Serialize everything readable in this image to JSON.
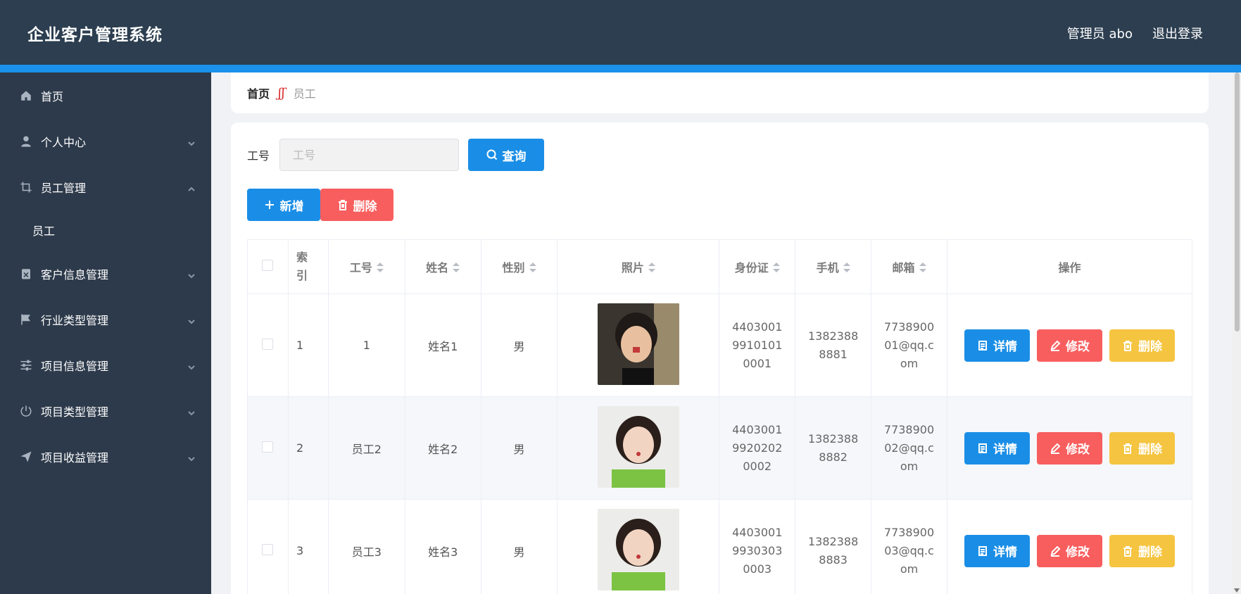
{
  "header": {
    "title": "企业客户管理系统",
    "user": "管理员 abo",
    "logout": "退出登录",
    "bg_color": "#2c3e50",
    "accent_color": "#1a91ea"
  },
  "sidebar": {
    "items": [
      {
        "label": "首页",
        "icon": "home-icon"
      },
      {
        "label": "个人中心",
        "icon": "user-icon",
        "expandable": true
      },
      {
        "label": "员工管理",
        "icon": "crop-icon",
        "expandable": true,
        "expanded": true
      },
      {
        "label": "员工",
        "submenu": true
      },
      {
        "label": "客户信息管理",
        "icon": "clipboard-icon",
        "expandable": true
      },
      {
        "label": "行业类型管理",
        "icon": "flag-icon",
        "expandable": true
      },
      {
        "label": "项目信息管理",
        "icon": "sliders-icon",
        "expandable": true
      },
      {
        "label": "项目类型管理",
        "icon": "power-icon",
        "expandable": true
      },
      {
        "label": "项目收益管理",
        "icon": "send-icon",
        "expandable": true
      }
    ]
  },
  "breadcrumb": {
    "home": "首页",
    "separator": "ʃʃ",
    "current": "员工"
  },
  "search": {
    "label": "工号",
    "placeholder": "工号",
    "value": "",
    "button": "查询"
  },
  "actions": {
    "add": "新增",
    "delete": "删除"
  },
  "table": {
    "columns": [
      "索引",
      "工号",
      "姓名",
      "性别",
      "照片",
      "身份证",
      "手机",
      "邮箱",
      "操作"
    ],
    "rows": [
      {
        "index": "1",
        "emp_no": "1",
        "name": "姓名1",
        "gender": "男",
        "id_card": "440300199101010001",
        "phone": "13823888881",
        "email": "773890001@qq.com"
      },
      {
        "index": "2",
        "emp_no": "员工2",
        "name": "姓名2",
        "gender": "男",
        "id_card": "440300199202020002",
        "phone": "13823888882",
        "email": "773890002@qq.com"
      },
      {
        "index": "3",
        "emp_no": "员工3",
        "name": "姓名3",
        "gender": "男",
        "id_card": "440300199303030003",
        "phone": "13823888883",
        "email": "773890003@qq.com"
      }
    ],
    "row_actions": {
      "detail": "详情",
      "edit": "修改",
      "delete": "删除"
    }
  },
  "colors": {
    "primary": "#1a8ee6",
    "danger": "#f85e5e",
    "warning": "#f5c440"
  }
}
